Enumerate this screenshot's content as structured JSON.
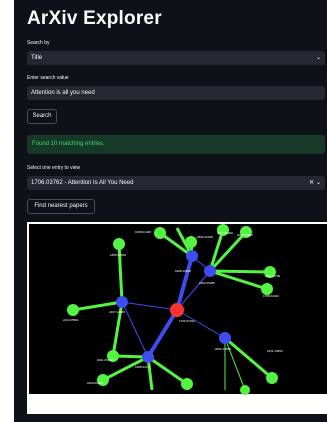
{
  "app": {
    "title": "ArXiv Explorer"
  },
  "search_by": {
    "label": "Search by",
    "value": "Title"
  },
  "search_value": {
    "label": "Enter search value",
    "value": "Attention is all you need"
  },
  "search_button": {
    "label": "Search"
  },
  "result": {
    "message": "Found 10 matching entries."
  },
  "entry_select": {
    "label": "Select one entry to view",
    "value": "1706.03762 - Attention Is All You Need"
  },
  "nearest_button": {
    "label": "Find nearest papers"
  },
  "graph": {
    "colors": {
      "background": "#000000",
      "center_node": "#ff3333",
      "hub_node": "#3f4cf0",
      "leaf_node": "#54f542",
      "hub_edge": "#3f4cf0",
      "leaf_edge": "#54f542"
    },
    "node_labels": [
      {
        "id": "center",
        "text": "1706.03762"
      },
      {
        "id": "hubA",
        "text": "1808.10188"
      },
      {
        "id": "hubB",
        "text": "1803.05289"
      },
      {
        "id": "hubC",
        "text": "2107.14868"
      },
      {
        "id": "hubD",
        "text": "1808.01177"
      },
      {
        "id": "hubE",
        "text": "2006.10838"
      },
      {
        "id": "l1",
        "text": "1805.01528"
      },
      {
        "id": "l2",
        "text": "1908.01328"
      },
      {
        "id": "l3",
        "text": "2007.03060"
      },
      {
        "id": "l4",
        "text": "2006.06263"
      },
      {
        "id": "l5",
        "text": "1110.11799"
      },
      {
        "id": "l6",
        "text": "1708.02222"
      },
      {
        "id": "l7",
        "text": "1808.10328"
      },
      {
        "id": "l8",
        "text": "2112.05591"
      },
      {
        "id": "l9",
        "text": "2021.05156"
      },
      {
        "id": "l10",
        "text": "2209.06823"
      },
      {
        "id": "l11",
        "text": "2311.10659"
      }
    ]
  }
}
